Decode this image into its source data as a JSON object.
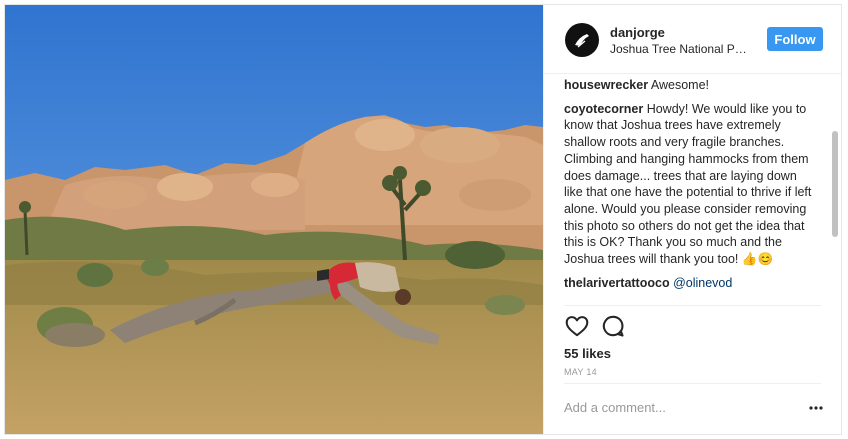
{
  "post": {
    "username": "danjorge",
    "location": "Joshua Tree National Park",
    "follow_label": "Follow",
    "likes": "55 likes",
    "date": "MAY 14",
    "add_comment_placeholder": "Add a comment..."
  },
  "comments": [
    {
      "user": "housewrecker",
      "text": "Awesome!"
    },
    {
      "user": "coyotecorner",
      "text": "Howdy! We would like you to know that Joshua trees have extremely shallow roots and very fragile branches. Climbing and hanging hammocks from them does damage... trees that are laying down like that one have the potential to thrive if left alone. Would you please consider removing this photo so others do not get the idea that this is OK? Thank you so much and the Joshua trees will thank you too! 👍😊"
    },
    {
      "user": "thelarivertattooco",
      "mention": "@olinevod"
    }
  ],
  "icons": {
    "like": "heart-outline-icon",
    "comment": "speech-bubble-icon",
    "more": "ellipsis-icon"
  },
  "colors": {
    "follow_button": "#3897f0",
    "sky": "#3f83d6",
    "mention": "#003569"
  }
}
